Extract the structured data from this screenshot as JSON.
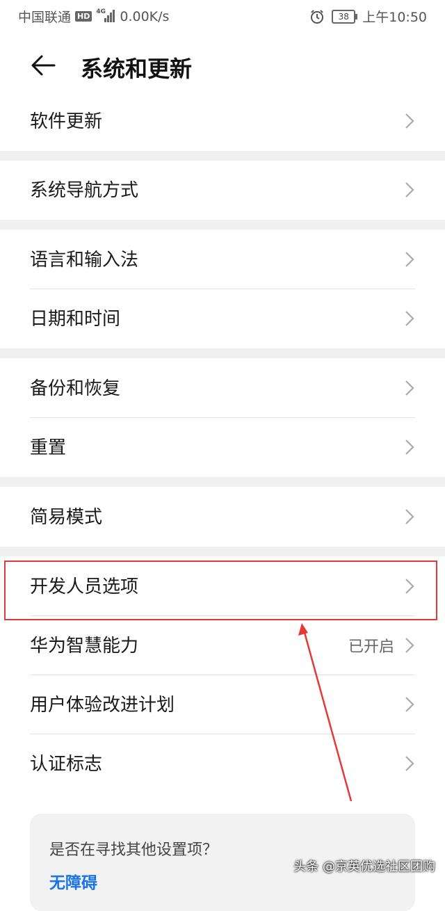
{
  "status": {
    "carrier": "中国联通",
    "hd": "HD",
    "network": "4G",
    "speed": "0.00K/s",
    "battery": "38",
    "time": "上午10:50"
  },
  "header": {
    "title": "系统和更新"
  },
  "items": [
    {
      "label": "软件更新"
    },
    {
      "label": "系统导航方式"
    },
    {
      "label": "语言和输入法"
    },
    {
      "label": "日期和时间"
    },
    {
      "label": "备份和恢复"
    },
    {
      "label": "重置"
    },
    {
      "label": "简易模式"
    },
    {
      "label": "开发人员选项"
    },
    {
      "label": "华为智慧能力",
      "value": "已开启"
    },
    {
      "label": "用户体验改进计划"
    },
    {
      "label": "认证标志"
    }
  ],
  "suggest": {
    "question": "是否在寻找其他设置项？",
    "link": "无障碍"
  },
  "watermark": "头条 @京英优选社区团购",
  "colors": {
    "annotation": "#e53935",
    "link": "#1a73e8",
    "section_gap": "#f0f0f0"
  }
}
